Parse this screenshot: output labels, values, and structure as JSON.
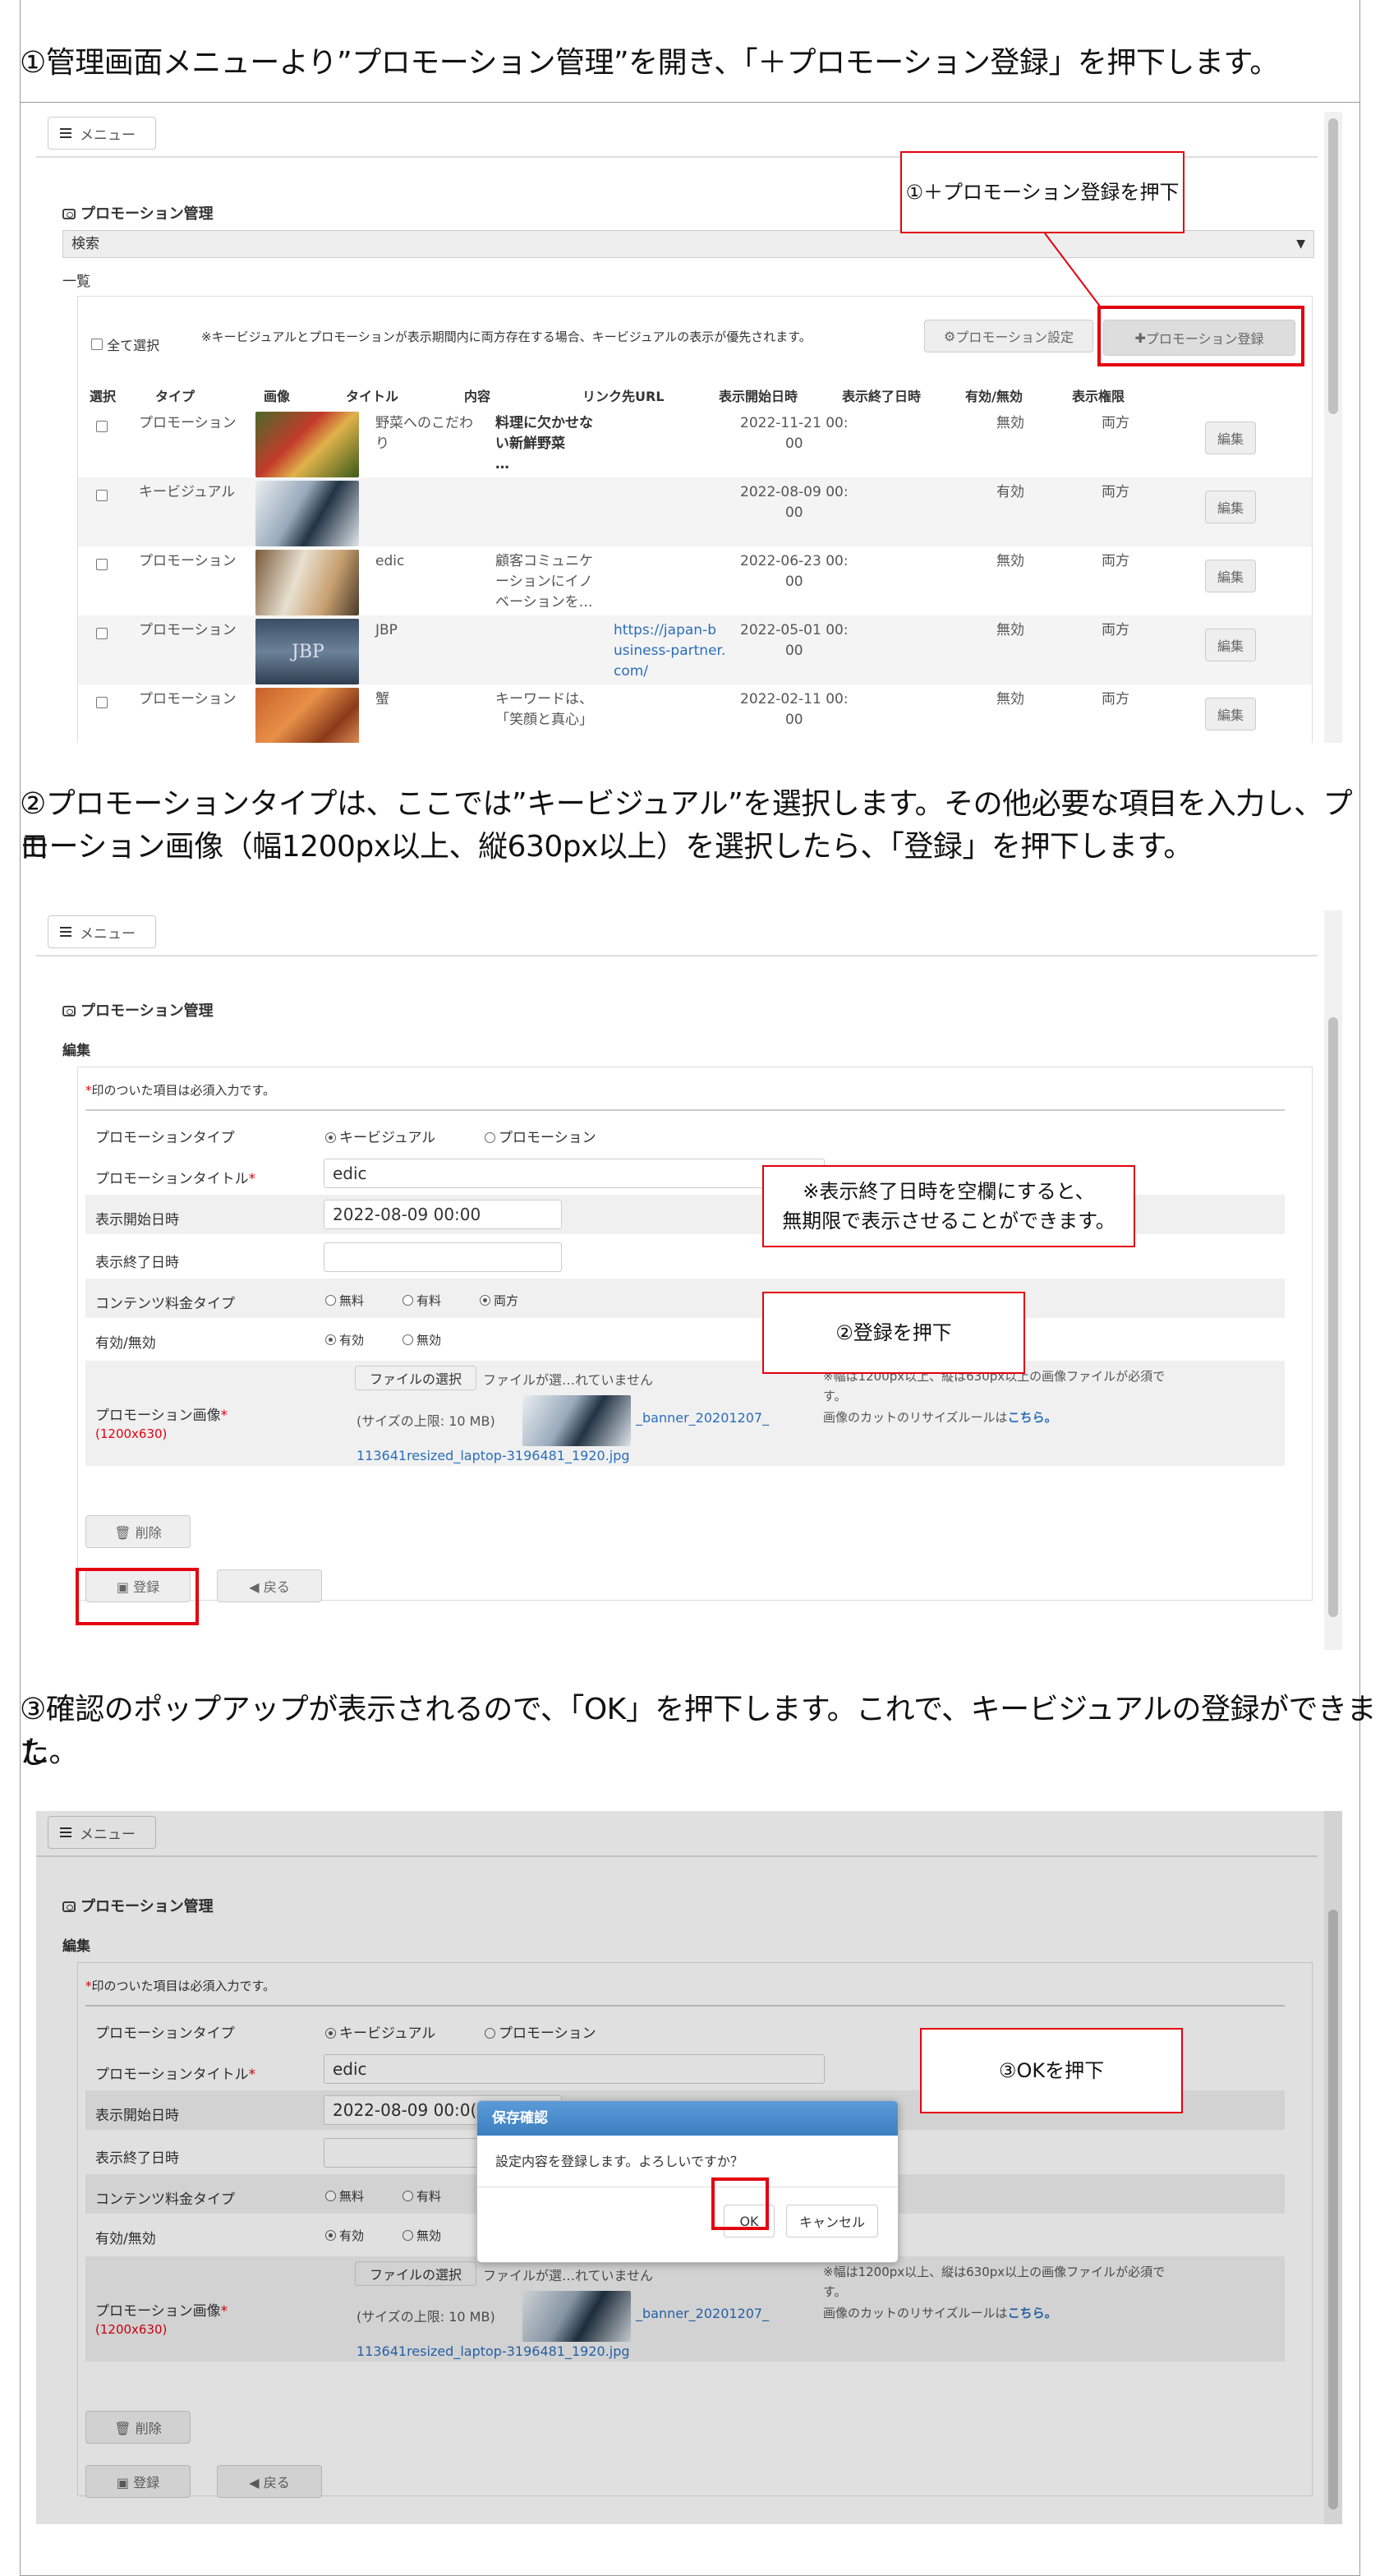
{
  "steps": {
    "s1": "①管理画面メニューより”プロモーション管理”を開き、「＋プロモーション登録」を押下します。",
    "s2a": "②プロモーションタイプは、ここでは”キービジュアル”を選択します。その他必要な項目を入力し、プロ",
    "s2b": "モーション画像（幅1200px以上、縦630px以上）を選択したら、「登録」を押下します。",
    "s3a": "③確認のポップアップが表示されるので、「OK」を押下します。これで、キービジュアルの登録ができまし",
    "s3b": "た。"
  },
  "callouts": {
    "c1": "①＋プロモーション登録を押下",
    "c2a": "※表示終了日時を空欄にすると、",
    "c2b": "無期限で表示させることができます。",
    "c3": "②登録を押下",
    "c4": "③OKを押下"
  },
  "menu": "メニュー",
  "title": "プロモーション管理",
  "list": {
    "search": "検索",
    "ichiran": "一覧",
    "select_all": "全て選択",
    "notice": "※キービジュアルとプロモーションが表示期間内に両方存在する場合、キービジュアルの表示が優先されます。",
    "btn_settings": "プロモーション設定",
    "btn_register": "プロモーション登録",
    "headers": [
      "選択",
      "タイプ",
      "画像",
      "タイトル",
      "内容",
      "リンク先URL",
      "表示開始日時",
      "表示終了日時",
      "有効/無効",
      "表示権限"
    ],
    "edit": "編集",
    "rows": [
      {
        "type": "プロモーション",
        "title": [
          "野菜へのこだわ",
          "り"
        ],
        "content": [
          "料理に欠かせな",
          "い新鮮野菜",
          "…"
        ],
        "url": [],
        "start": [
          "2022-11-21 00:",
          "00"
        ],
        "status": "無効",
        "perm": "両方"
      },
      {
        "type": "キービジュアル",
        "title": [],
        "content": [],
        "url": [],
        "start": [
          "2022-08-09 00:",
          "00"
        ],
        "status": "有効",
        "perm": "両方"
      },
      {
        "type": "プロモーション",
        "title": [
          "edic"
        ],
        "content": [
          "顧客コミュニケ",
          "ーションにイノ",
          "ベーションを…"
        ],
        "url": [],
        "start": [
          "2022-06-23 00:",
          "00"
        ],
        "status": "無効",
        "perm": "両方"
      },
      {
        "type": "プロモーション",
        "title": [
          "JBP"
        ],
        "content": [],
        "url": [
          "https://japan-b",
          "usiness-partner.",
          "com/"
        ],
        "start": [
          "2022-05-01 00:",
          "00"
        ],
        "status": "無効",
        "perm": "両方"
      },
      {
        "type": "プロモーション",
        "title": [
          "蟹"
        ],
        "content": [
          "キーワードは、",
          "「笑顔と真心」"
        ],
        "url": [],
        "start": [
          "2022-02-11 00:",
          "00"
        ],
        "status": "無効",
        "perm": "両方"
      }
    ],
    "jbp_text": "JBP"
  },
  "form": {
    "edit": "編集",
    "required_note": "印のついた項目は必須入力です。",
    "asterisk": "*",
    "type_label": "プロモーションタイプ",
    "type_opt1": "キービジュアル",
    "type_opt2": "プロモーション",
    "title_label": "プロモーションタイトル",
    "title_value": "edic",
    "start_label": "表示開始日時",
    "start_value": "2022-08-09 00:00",
    "start_value_cut": "2022-08-09 00:0(",
    "end_label": "表示終了日時",
    "fee_label": "コンテンツ料金タイプ",
    "fee_opts": [
      "無料",
      "有料",
      "両方"
    ],
    "active_label": "有効/無効",
    "active_opts": [
      "有効",
      "無効"
    ],
    "image_label": "プロモーション画像",
    "image_size": "1200x630",
    "file_btn": "ファイルの選択",
    "file_none": "ファイルが選…れていません",
    "size_limit": "(サイズの上限: 10 MB)",
    "filename_a": "_banner_20201207_",
    "filename_b": "113641resized_laptop-3196481_1920.jpg",
    "note1": "※幅は1200px以上、縦は630px以上の画像ファイルが必須で",
    "note2": "す。",
    "note3a": "画像のカットのリサイズルールは",
    "note3b": "こちら。",
    "btn_delete": "削除",
    "btn_save": "登録",
    "btn_back": "戻る"
  },
  "dialog": {
    "title": "保存確認",
    "message": "設定内容を登録します。よろしいですか？",
    "ok": "OK",
    "cancel": "キャンセル"
  },
  "colors": {
    "accent_red": "#e3000f",
    "dialog_blue": "#3c7fc0"
  }
}
